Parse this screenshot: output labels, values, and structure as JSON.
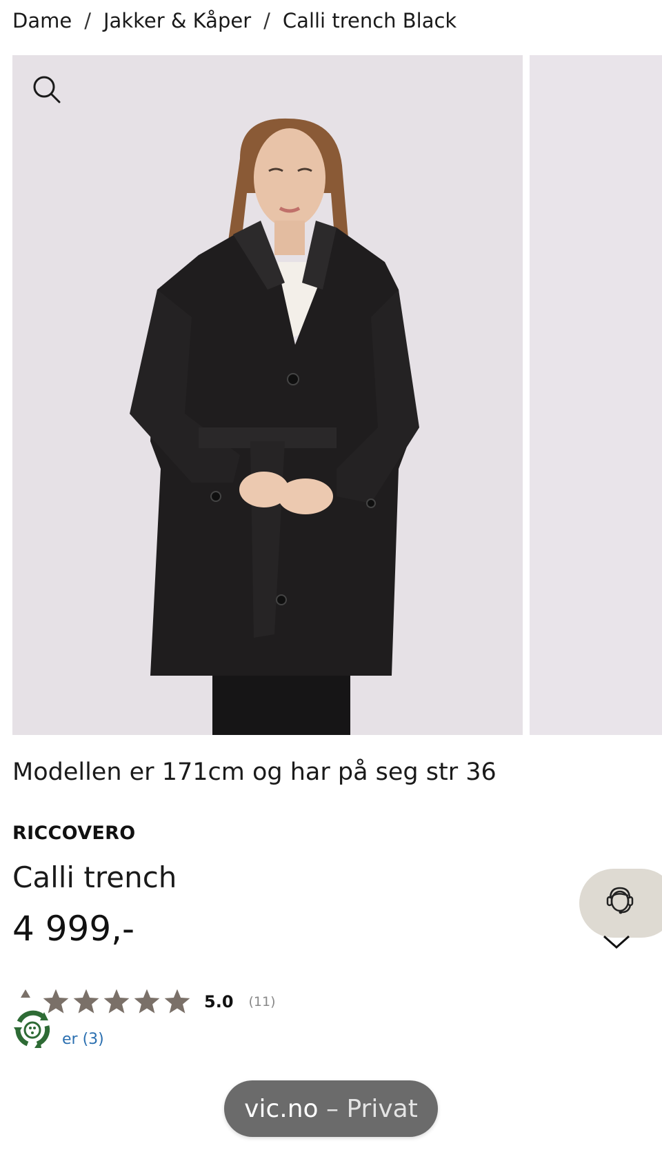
{
  "breadcrumb": {
    "items": [
      "Dame",
      "Jakker & Kåper",
      "Calli trench Black"
    ],
    "separator": "/"
  },
  "gallery": {
    "zoom_icon": "search-icon",
    "images": [
      {
        "alt": "Calli trench Black"
      },
      {
        "alt": "Calli trench Black"
      }
    ]
  },
  "product": {
    "model_info": "Modellen er 171cm og har på seg str 36",
    "brand": "RICCOVERO",
    "name": "Calli trench",
    "price": "4 999,-"
  },
  "rating": {
    "value": "5.0",
    "count": "(11)",
    "stars": 5,
    "star_color": "#7a7068",
    "reviews_link": "er (3)"
  },
  "support": {
    "icon": "support-agent-icon",
    "background": "#dedad2"
  },
  "browser": {
    "domain": "vic.no",
    "separator": " – ",
    "mode": "Privat"
  },
  "colors": {
    "link": "#2a6fb0",
    "photo_background": "#e6e1e6",
    "coat": "#1f1d1e"
  }
}
